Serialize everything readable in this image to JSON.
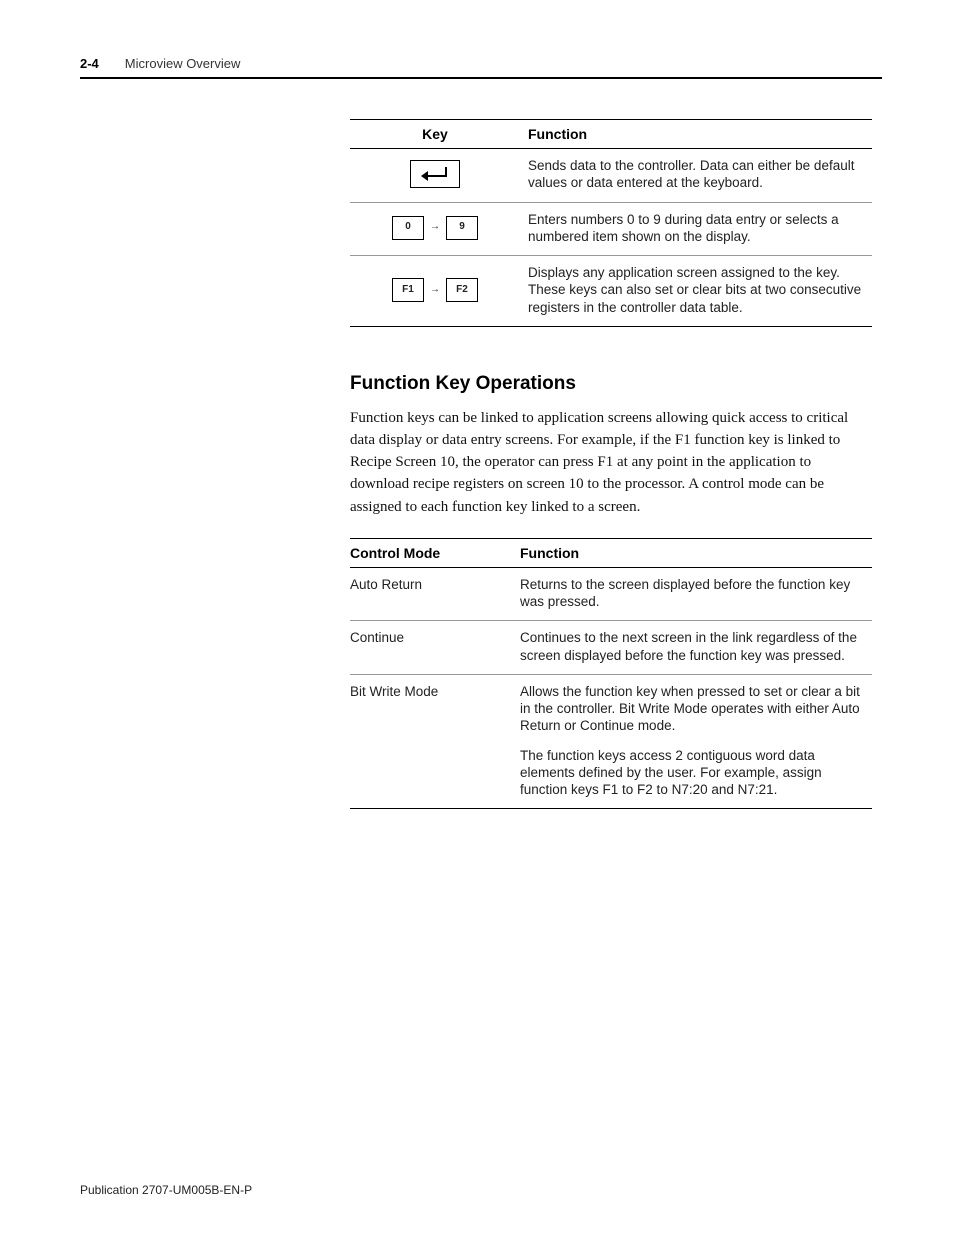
{
  "header": {
    "page_num": "2-4",
    "title": "Microview Overview"
  },
  "key_table": {
    "headers": {
      "key": "Key",
      "function": "Function"
    },
    "rows": [
      {
        "key_type": "enter",
        "function": "Sends data to the controller. Data can either be default values or data entered at the keyboard."
      },
      {
        "key_type": "numbers",
        "left_label": "0",
        "right_label": "9",
        "function": "Enters numbers 0 to 9 during data entry or selects a numbered item shown on the display."
      },
      {
        "key_type": "fkeys",
        "left_label": "F1",
        "right_label": "F2",
        "function": "Displays any application screen assigned to the key. These keys can also set or clear bits at two consecutive registers in the controller data table."
      }
    ]
  },
  "section": {
    "heading": "Function Key Operations",
    "body": "Function keys can be linked to application screens allowing quick access to critical data display or data entry screens.  For example, if the F1 function key is linked to Recipe Screen 10, the operator can press F1 at any point in the application to download recipe registers on screen 10 to the processor.  A control mode can be assigned to each function key linked to a screen."
  },
  "mode_table": {
    "headers": {
      "mode": "Control Mode",
      "function": "Function"
    },
    "rows": [
      {
        "mode": "Auto Return",
        "function": "Returns to the screen displayed before the function key was pressed."
      },
      {
        "mode": "Continue",
        "function": "Continues to the next screen in the link regardless of the screen displayed before the function key was pressed."
      },
      {
        "mode": "Bit Write Mode",
        "function_p1": "Allows the function key when pressed to set or clear a bit in the controller. Bit Write Mode operates with either Auto Return or Continue mode.",
        "function_p2": "The function keys access 2 contiguous word data elements defined by the user. For example, assign function keys F1 to F2 to N7:20 and N7:21."
      }
    ]
  },
  "footer": {
    "pub": "Publication 2707-UM005B-EN-P"
  }
}
